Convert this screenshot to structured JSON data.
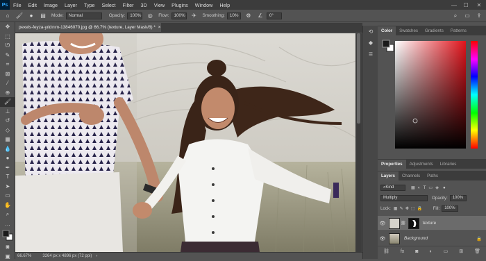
{
  "app": {
    "logo": "Ps"
  },
  "menu": [
    "File",
    "Edit",
    "Image",
    "Layer",
    "Type",
    "Select",
    "Filter",
    "3D",
    "View",
    "Plugins",
    "Window",
    "Help"
  ],
  "window_controls": [
    "—",
    "☐",
    "✕"
  ],
  "options": {
    "mode_label": "Mode:",
    "mode_value": "Normal",
    "opacity_label": "Opacity:",
    "opacity_value": "100%",
    "flow_label": "Flow:",
    "flow_value": "100%",
    "smoothing_label": "Smoothing:",
    "smoothing_value": "10%",
    "angle_value": "0°"
  },
  "document": {
    "tab_title": "pexels-feyza-yıldırım-13846070.jpg @ 66.7% (texture, Layer Mask/8) *",
    "close_glyph": "×"
  },
  "status": {
    "zoom": "66.67%",
    "info": "3264 px x 4896 px (72 ppi)",
    "arrow": "›"
  },
  "color_panel": {
    "tabs": [
      "Color",
      "Swatches",
      "Gradients",
      "Patterns"
    ],
    "colors": {
      "foreground": "#1a1a1a",
      "background": "#ffffff",
      "hue": "#e0131b"
    }
  },
  "properties_panel": {
    "tabs": [
      "Properties",
      "Adjustments",
      "Libraries"
    ]
  },
  "layers_panel": {
    "tabs": [
      "Layers",
      "Channels",
      "Paths"
    ],
    "kind_value": "Kind",
    "blend_value": "Multiply",
    "opacity_label": "Opacity:",
    "opacity_value": "100%",
    "lock_label": "Lock:",
    "fill_label": "Fill:",
    "fill_value": "100%",
    "layers": [
      {
        "name": "texture",
        "selected": true
      },
      {
        "name": "Background",
        "selected": false
      }
    ]
  },
  "tools": [
    "move-icon",
    "marquee-icon",
    "lasso-icon",
    "quick-select-icon",
    "crop-icon",
    "frame-icon",
    "eyedropper-icon",
    "healing-icon",
    "brush-icon",
    "stamp-icon",
    "history-brush-icon",
    "eraser-icon",
    "gradient-icon",
    "blur-icon",
    "dodge-icon",
    "pen-icon",
    "type-icon",
    "path-select-icon",
    "rectangle-icon",
    "hand-icon",
    "zoom-icon",
    "more-icon",
    "color-swatch-icon",
    "quickmask-icon",
    "screenmode-icon"
  ]
}
